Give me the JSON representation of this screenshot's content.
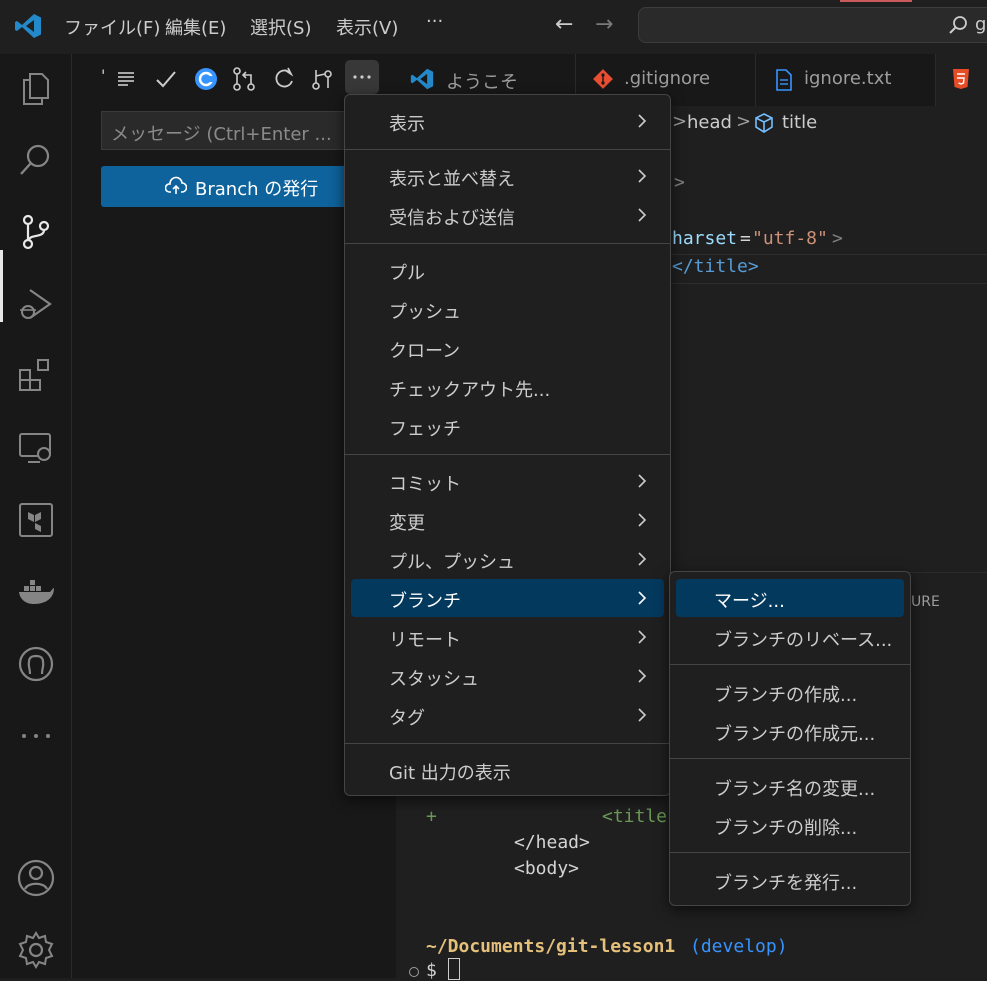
{
  "menubar": {
    "file": "ファイル(F)",
    "edit": "編集(E)",
    "selection": "選択(S)",
    "view": "表示(V)",
    "more": "···"
  },
  "command_center": {
    "text": "g"
  },
  "sidebar": {
    "message_placeholder": "メッセージ (Ctrl+Enter ...",
    "publish_button": "Branch の発行",
    "cursor_fragment": "'"
  },
  "tabs": [
    {
      "label": "ようこそ"
    },
    {
      "label": ".gitignore"
    },
    {
      "label": "ignore.txt"
    }
  ],
  "breadcrumb": {
    "head": "head",
    "sep": ">",
    "title": "title"
  },
  "code": {
    "l1": ">",
    "l2_attr": "harset",
    "l2_eq": "=",
    "l2_val": "\"utf-8\"",
    "l2_close": ">",
    "l3": "</title>"
  },
  "panel": {
    "ignored_label": "URE",
    "plus": "+",
    "title_frag": "<title",
    "head_close": "</head>",
    "body_open": "<body>",
    "path": "~/Documents/git-lesson1",
    "branch": "(develop)",
    "prompt": "$"
  },
  "main_menu": [
    {
      "label": "表示",
      "submenu": true
    },
    {
      "label": "表示と並べ替え",
      "submenu": true
    },
    {
      "label": "受信および送信",
      "submenu": true
    },
    {
      "label": "プル",
      "submenu": false
    },
    {
      "label": "プッシュ",
      "submenu": false
    },
    {
      "label": "クローン",
      "submenu": false
    },
    {
      "label": "チェックアウト先...",
      "submenu": false
    },
    {
      "label": "フェッチ",
      "submenu": false
    },
    {
      "label": "コミット",
      "submenu": true
    },
    {
      "label": "変更",
      "submenu": true
    },
    {
      "label": "プル、プッシュ",
      "submenu": true
    },
    {
      "label": "ブランチ",
      "submenu": true
    },
    {
      "label": "リモート",
      "submenu": true
    },
    {
      "label": "スタッシュ",
      "submenu": true
    },
    {
      "label": "タグ",
      "submenu": true
    },
    {
      "label": "Git 出力の表示",
      "submenu": false
    }
  ],
  "branch_menu": [
    {
      "label": "マージ..."
    },
    {
      "label": "ブランチのリベース..."
    },
    {
      "label": "ブランチの作成..."
    },
    {
      "label": "ブランチの作成元..."
    },
    {
      "label": "ブランチ名の変更..."
    },
    {
      "label": "ブランチの削除..."
    },
    {
      "label": "ブランチを発行..."
    }
  ],
  "colors": {
    "accent": "#0e639c",
    "menu_highlight": "#04395e",
    "branch": "#3794ff",
    "path": "#e5c07b"
  }
}
